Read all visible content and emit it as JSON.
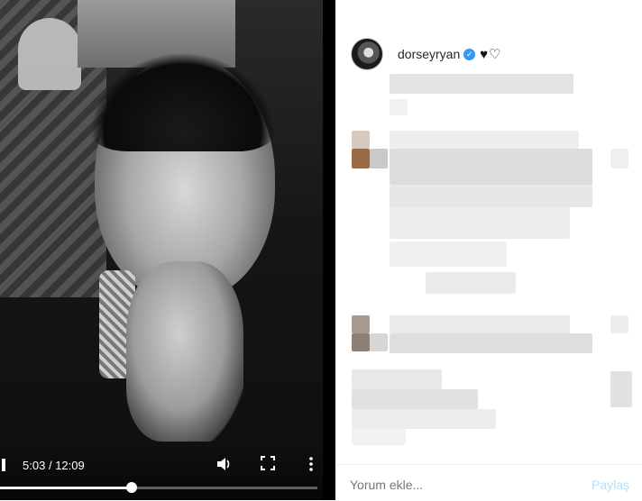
{
  "video": {
    "current_time": "5:03",
    "separator": "/",
    "duration": "12:09",
    "progress_fraction": 0.415,
    "icons": [
      "volume-icon",
      "fullscreen-icon",
      "more-options-icon"
    ]
  },
  "post": {
    "username": "dorseyryan",
    "verified": true,
    "emoji": [
      "black-heart",
      "white-heart"
    ]
  },
  "comment_form": {
    "placeholder": "Yorum ekle...",
    "share_label": "Paylaş"
  },
  "colors": {
    "verified_blue": "#3897f0",
    "share_text": "#b2dffc",
    "placeholder_text": "#8e8e8e"
  }
}
